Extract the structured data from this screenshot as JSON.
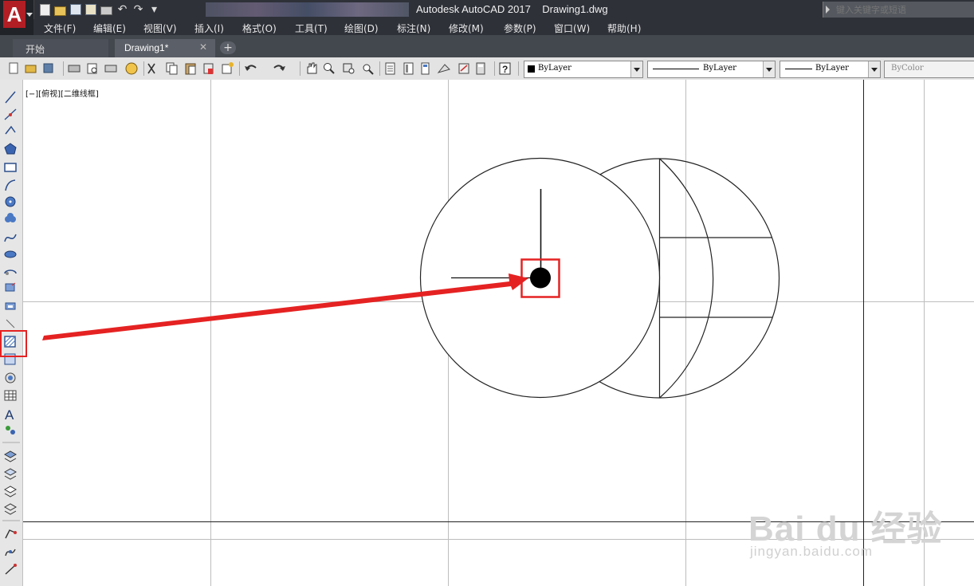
{
  "titlebar": {
    "app_title": "Autodesk AutoCAD 2017",
    "document_title": "Drawing1.dwg",
    "help_search_placeholder": "键入关键字或短语"
  },
  "menu": [
    "文件(F)",
    "编辑(E)",
    "视图(V)",
    "插入(I)",
    "格式(O)",
    "工具(T)",
    "绘图(D)",
    "标注(N)",
    "修改(M)",
    "参数(P)",
    "窗口(W)",
    "帮助(H)"
  ],
  "tabs": {
    "start": "开始",
    "drawing": "Drawing1*",
    "close": "✕",
    "add": "+"
  },
  "properties": {
    "color": "ByLayer",
    "linetype": "ByLayer",
    "lineweight": "ByLayer",
    "plotstyle": "ByColor"
  },
  "viewport": {
    "label": "[−][俯视][二维线框]"
  },
  "watermark": {
    "brand": "Bai du 经验",
    "url": "jingyan.baidu.com"
  },
  "colors": {
    "annotation_red": "#e52222",
    "autocad_red": "#b11e24",
    "chrome_dark": "#2e3138"
  },
  "icons": {
    "draw_toolbar": [
      "line-icon",
      "construction-line-icon",
      "polyline-icon",
      "polygon-icon",
      "rectangle-icon",
      "arc-icon",
      "circle-icon",
      "revision-cloud-icon",
      "spline-icon",
      "ellipse-icon",
      "ellipse-arc-icon",
      "insert-block-icon",
      "make-block-icon",
      "point-icon",
      "hatch-icon",
      "gradient-icon",
      "region-icon",
      "table-icon",
      "multiline-text-icon",
      "add-selected-icon"
    ],
    "highlighted_tool": "hatch-icon"
  }
}
